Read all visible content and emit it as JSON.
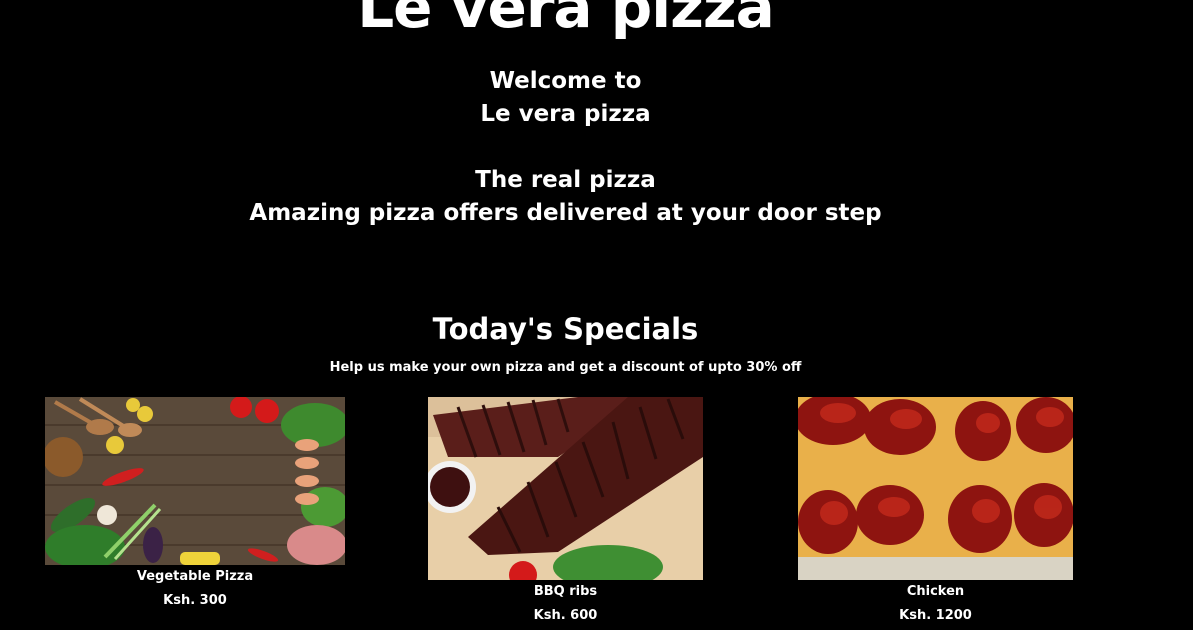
{
  "header": {
    "title": "Le vera pizza"
  },
  "hero": {
    "welcome_line1": "Welcome to",
    "welcome_line2": "Le vera pizza",
    "tagline_line1": "The real pizza",
    "tagline_line2": "Amazing pizza offers delivered at your door step"
  },
  "specials": {
    "heading": "Today's Specials",
    "subheading": "Help us make your own pizza and get a discount of upto 30% off",
    "items": [
      {
        "name": "Vegetable Pizza",
        "price": "Ksh. 300"
      },
      {
        "name": "BBQ ribs",
        "price": "Ksh. 600"
      },
      {
        "name": "Chicken",
        "price": "Ksh. 1200"
      }
    ]
  },
  "colors": {
    "background": "#000000",
    "text": "#ffffff"
  }
}
